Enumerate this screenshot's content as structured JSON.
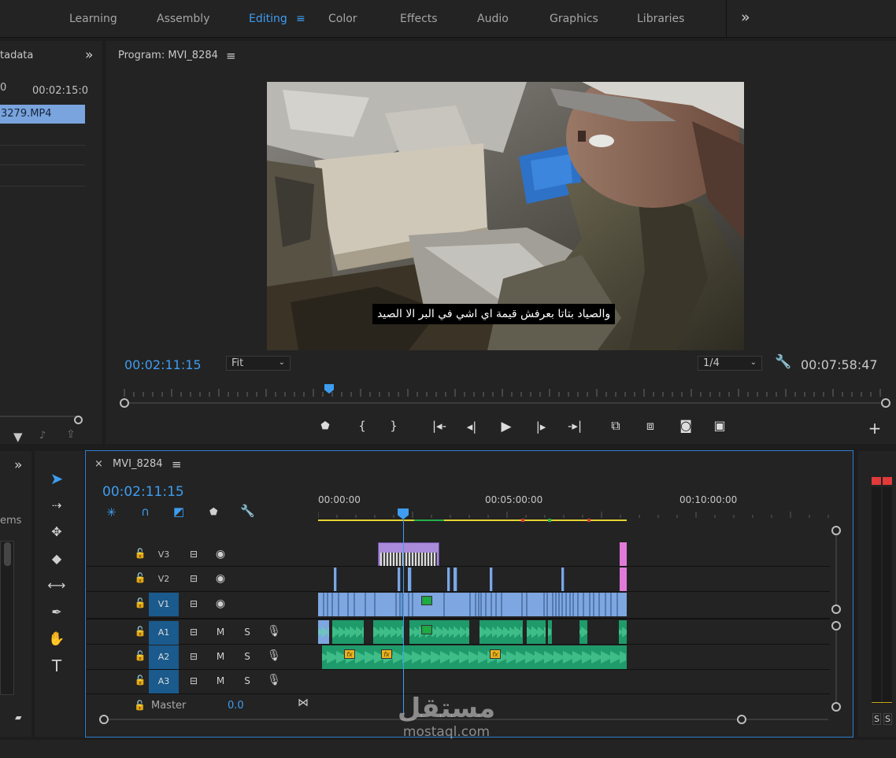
{
  "workspaces": [
    "Learning",
    "Assembly",
    "Editing",
    "Color",
    "Effects",
    "Audio",
    "Graphics",
    "Libraries"
  ],
  "active_workspace": "Editing",
  "more_glyph": "»",
  "left_panel": {
    "header": "tadata",
    "timecode_a": "0",
    "timecode_b": "00:02:15:0",
    "selected_clip": "3279.MP4"
  },
  "program": {
    "title": "Program: MVI_8284",
    "menu_glyph": "≡",
    "subtitle": "والصياد بتاتا بعرفش قيمة اي اشي في البر الا الصيد",
    "timecode": "00:02:11:15",
    "fit": "Fit",
    "resolution": "1/4",
    "duration": "00:07:58:47",
    "playhead_fraction": 0.27
  },
  "project_panel": {
    "label": "ems"
  },
  "timeline": {
    "close_glyph": "×",
    "sequence": "MVI_8284",
    "timecode": "00:02:11:15",
    "ruler": [
      "00:00:00",
      "00:05:00:00",
      "00:10:00:00"
    ],
    "video_tracks": [
      "V3",
      "V2",
      "V1"
    ],
    "audio_tracks": [
      "A1",
      "A2",
      "A3"
    ],
    "m_label": "M",
    "s_label": "S",
    "master_label": "Master",
    "master_value": "0.0",
    "fx_label": "fx"
  },
  "meter": {
    "solo_labels": [
      "S",
      "S"
    ]
  },
  "watermark": {
    "brand": "مستقل",
    "domain": "mostaql.com"
  },
  "colors": {
    "accent": "#3e9df0",
    "video_clip": "#7ea6e0",
    "audio_clip": "#1f9a6a",
    "graphic_clip": "#a98bd9",
    "pink_clip": "#e07ad8",
    "fx_badge": "#e8b320"
  }
}
